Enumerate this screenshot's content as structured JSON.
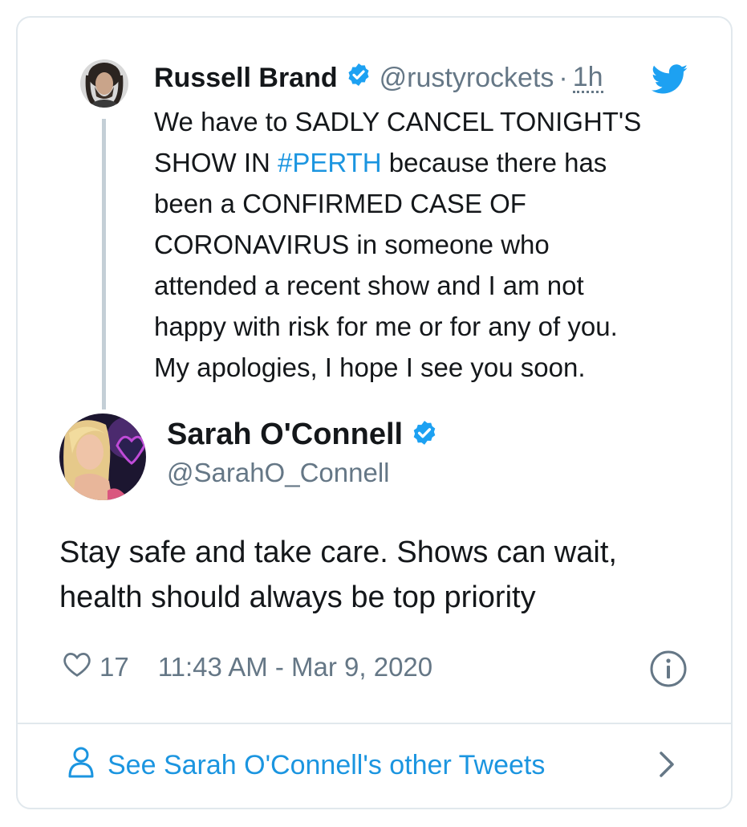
{
  "quoted_tweet": {
    "name": "Russell Brand",
    "handle": "@rustyrockets",
    "separator": "·",
    "time": "1h",
    "text_lines": [
      [
        "We have to SADLY CANCEL TONIGHT'S"
      ],
      [
        "SHOW IN ",
        "#PERTH",
        " because there has"
      ],
      [
        "been a CONFIRMED CASE OF"
      ],
      [
        "CORONAVIRUS in someone who"
      ],
      [
        "attended a recent show and I am not"
      ],
      [
        "happy with risk for me or for any of you."
      ],
      [
        "My apologies, I hope I see you soon."
      ]
    ]
  },
  "tweet": {
    "name": "Sarah O'Connell",
    "handle": "@SarahO_Connell",
    "text_line1": "Stay safe and take care. Shows can wait,",
    "text_line2": "health should always be top priority",
    "likes": "17",
    "timestamp": "11:43 AM - Mar 9, 2020"
  },
  "footer": {
    "label": "See Sarah O'Connell's other Tweets"
  },
  "colors": {
    "link_blue": "#1b95e0",
    "verified_blue": "#1da1f2",
    "muted": "#657786",
    "border": "#e1e8ed"
  },
  "icons": [
    "verified-badge-icon",
    "twitter-bird-icon",
    "heart-icon",
    "info-icon",
    "person-icon",
    "chevron-right-icon"
  ]
}
